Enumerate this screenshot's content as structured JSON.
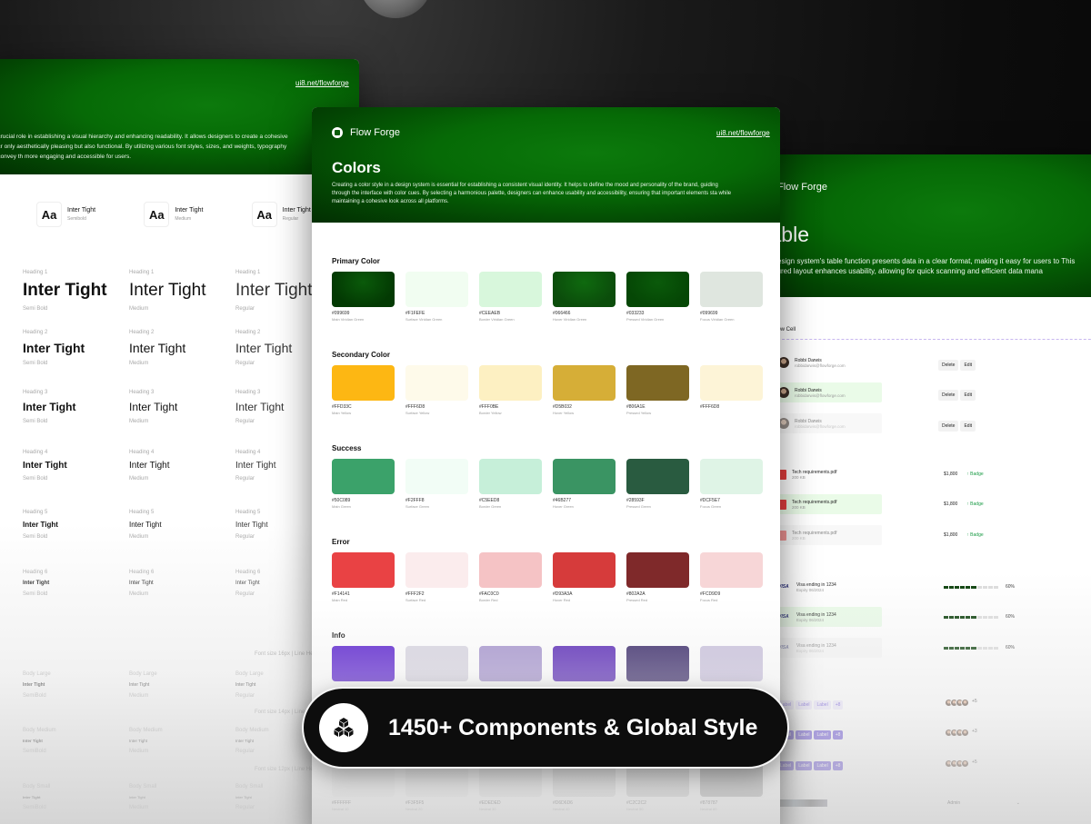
{
  "typography": {
    "link": "ui8.net/flowforge",
    "description": "ays a crucial role in establishing a visual hierarchy and enhancing readability. It allows designers to create a cohesive look acr only aesthetically pleasing but also functional. By utilizing various font styles, sizes, and weights, typography helps convey th more engaging and accessible for users.",
    "fonts": [
      {
        "glyph": "Aa",
        "name": "Inter Tight",
        "weight": "Semibold"
      },
      {
        "glyph": "Aa",
        "name": "Inter Tight",
        "weight": "Medium"
      },
      {
        "glyph": "Aa",
        "name": "Inter Tight",
        "weight": "Regular"
      }
    ],
    "sample": "Inter Tight",
    "headings": [
      "Heading 1",
      "Heading 2",
      "Heading 3",
      "Heading 4",
      "Heading 5",
      "Heading 6"
    ],
    "weights": [
      "Semi Bold",
      "Medium",
      "Regular"
    ],
    "body_labels": [
      "Body Large",
      "Body Medium",
      "Body Small"
    ],
    "body_weights": [
      "SemiBold",
      "Medium",
      "Regular"
    ],
    "notes": [
      "Font size 16px | Line Hei",
      "Font size 14px | Line Hei",
      "Font size 12px | Line Hei"
    ]
  },
  "colors": {
    "brand": "Flow Forge",
    "link": "ui8.net/flowforge",
    "title": "Colors",
    "description": "Creating a color style in a design system is essential for establishing a consistent visual identity. It helps to define the mood and personality of the brand, guiding through the interface with color cues. By selecting a harmonious palette, designers can enhance usability and accessibility, ensuring that important elements sta while maintaining a cohesive look across all platforms.",
    "sections": [
      {
        "title": "Primary Color",
        "swatches": [
          {
            "hex": "#099699",
            "name": "Main Viridian Green",
            "color": "#033a03"
          },
          {
            "hex": "#F1FEFE",
            "name": "Surface Viridian Green",
            "color": "#f1fdf1"
          },
          {
            "hex": "#CEEAEB",
            "name": "Border Viridian Green",
            "color": "#d8f7dc"
          },
          {
            "hex": "#066466",
            "name": "Hover Viridian Green",
            "color": "#0b4d0b"
          },
          {
            "hex": "#033233",
            "name": "Pressed Viridian Green",
            "color": "#054705"
          },
          {
            "hex": "#099699",
            "name": "Focus Viridian Green",
            "color": "#dfe6df"
          }
        ]
      },
      {
        "title": "Secondary Color",
        "swatches": [
          {
            "hex": "#FFD33C",
            "name": "Main Yellow",
            "color": "#fdb713"
          },
          {
            "hex": "#FFF6D8",
            "name": "Surface Yellow",
            "color": "#fefaea"
          },
          {
            "hex": "#FFF0BE",
            "name": "Border Yellow",
            "color": "#fdf0c2"
          },
          {
            "hex": "#D5B032",
            "name": "Hover Yellow",
            "color": "#d6ae37"
          },
          {
            "hex": "#806A1E",
            "name": "Pressed Yellow",
            "color": "#7e6723"
          },
          {
            "hex": "#FFF6D8",
            "name": "",
            "color": "#fdf4d7"
          }
        ]
      },
      {
        "title": "Success",
        "swatches": [
          {
            "hex": "#50C089",
            "name": "Main Green",
            "color": "#3ba26a"
          },
          {
            "hex": "#F2FFF8",
            "name": "Surface Green",
            "color": "#f2fdf6"
          },
          {
            "hex": "#C5EED8",
            "name": "Border Green",
            "color": "#c6efd9"
          },
          {
            "hex": "#46B277",
            "name": "Hover Green",
            "color": "#3a9463"
          },
          {
            "hex": "#28593F",
            "name": "Pressed Green",
            "color": "#295b40"
          },
          {
            "hex": "#DCF5E7",
            "name": "Focus Green",
            "color": "#dff4e6"
          }
        ]
      },
      {
        "title": "Error",
        "swatches": [
          {
            "hex": "#F14141",
            "name": "Main Red",
            "color": "#e94244"
          },
          {
            "hex": "#FFF2F2",
            "name": "Surface Red",
            "color": "#fbeced"
          },
          {
            "hex": "#FAC0C0",
            "name": "Border Red",
            "color": "#f5c3c5"
          },
          {
            "hex": "#D93A3A",
            "name": "Hover Red",
            "color": "#d63b3b"
          },
          {
            "hex": "#802A2A",
            "name": "Pressed Red",
            "color": "#7f292a"
          },
          {
            "hex": "#FCD9D9",
            "name": "Focus Red",
            "color": "#f7d6d7"
          }
        ]
      },
      {
        "title": "Info",
        "swatches": [
          {
            "hex": "",
            "name": "",
            "color": "#5a21d0"
          },
          {
            "hex": "",
            "name": "",
            "color": "#d9d6e2"
          },
          {
            "hex": "",
            "name": "",
            "color": "#a796cf"
          },
          {
            "hex": "",
            "name": "",
            "color": "#5a2ab8"
          },
          {
            "hex": "",
            "name": "",
            "color": "#3a2a6a"
          },
          {
            "hex": "",
            "name": "",
            "color": "#cbc3de"
          }
        ]
      },
      {
        "title": "",
        "swatches": [
          {
            "hex": "#FFFFFF",
            "name": "Neutral 10",
            "color": "#f3f3f3"
          },
          {
            "hex": "#F3F5F5",
            "name": "Neutral 20",
            "color": "#eeeeee"
          },
          {
            "hex": "#EDEDED",
            "name": "Neutral 30",
            "color": "#e6e6e6"
          },
          {
            "hex": "#D6D6D6",
            "name": "Neutral 40",
            "color": "#dadada"
          },
          {
            "hex": "#C2C2C2",
            "name": "Neutral 50",
            "color": "#c6c6c6"
          },
          {
            "hex": "#878787",
            "name": "Neutral 60",
            "color": "#9a9a9a"
          }
        ]
      }
    ]
  },
  "table": {
    "brand": "Flow Forge",
    "title": "Table",
    "description": "Our design system's table function presents data in a clear format, making it easy for users to This structured layout enhances usability, allowing for quick scanning and efficient data mana",
    "row_cell_label": "Table Row Cell",
    "user": {
      "name": "Robbi Darwis",
      "email": "robbidarwis@flowforge.com"
    },
    "actions": [
      "Delete",
      "Edit"
    ],
    "file": {
      "name": "Tech requirements.pdf",
      "size": "200 KB"
    },
    "price": "$1,800",
    "badge": "↑ Badge",
    "card": {
      "title": "Visa ending in 1234",
      "expiry": "Expiry 06/2024",
      "brand": "VISA",
      "progress": 0.6,
      "progress_label": "60%"
    },
    "label": "Label",
    "label_more": "+8",
    "avatars_more": "+5",
    "avatars_more_2": "+3",
    "select_value": "Admin"
  },
  "banner": {
    "text": "1450+ Components & Global Style",
    "icon": "stacked-cubes-icon"
  }
}
